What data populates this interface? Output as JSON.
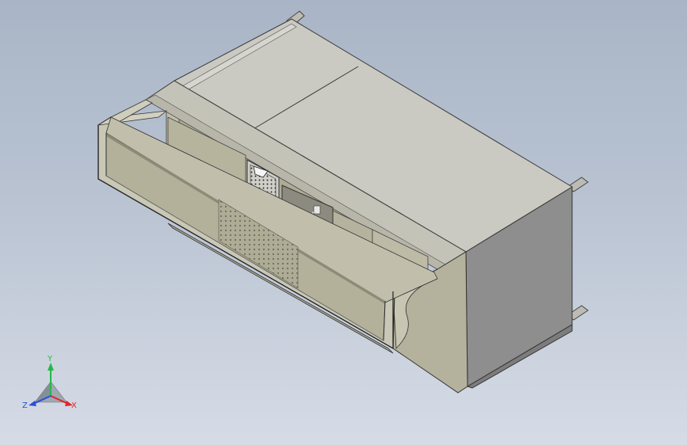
{
  "viewport": {
    "background_top": "#a9b5c6",
    "background_bottom": "#d6dce6"
  },
  "colors": {
    "panel_face": "#b3b19a",
    "panel_light": "#cfcdbb",
    "top_face": "#cac9c2",
    "side_face": "#8b8b8b",
    "frame_edge": "#3a3a3a",
    "interior_dark": "#8c8b80"
  },
  "triad": {
    "x_label": "X",
    "y_label": "Y",
    "z_label": "Z",
    "x_color": "#e0262b",
    "y_color": "#23b84a",
    "z_color": "#2b4fd8"
  }
}
